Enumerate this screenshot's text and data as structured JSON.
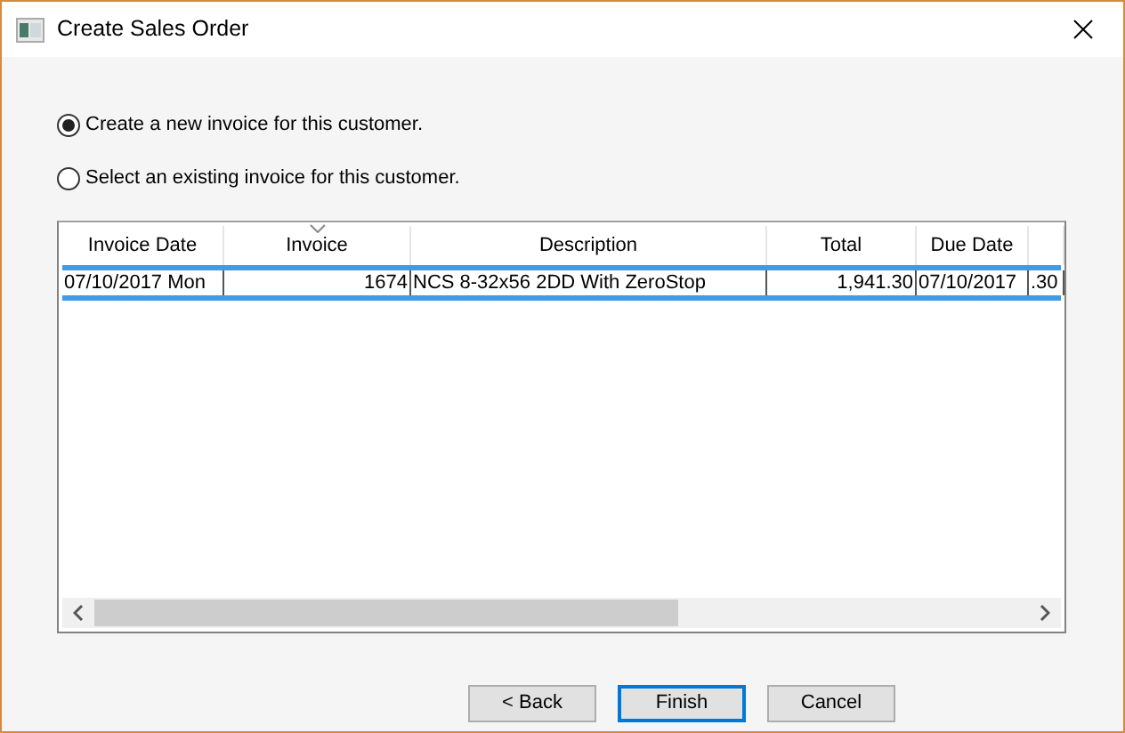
{
  "window": {
    "title": "Create Sales Order"
  },
  "options": [
    {
      "label": "Create a new invoice for this customer.",
      "selected": true
    },
    {
      "label": "Select an existing invoice for this customer.",
      "selected": false
    }
  ],
  "table": {
    "columns": [
      {
        "label": "Invoice Date",
        "kind": "text",
        "sorted": false
      },
      {
        "label": "Invoice",
        "kind": "number",
        "sorted": true
      },
      {
        "label": "Description",
        "kind": "text",
        "sorted": false
      },
      {
        "label": "Total",
        "kind": "number",
        "sorted": false
      },
      {
        "label": "Due Date",
        "kind": "text",
        "sorted": false
      },
      {
        "kind": "text",
        "sorted": false
      }
    ],
    "rows": [
      {
        "selected": true,
        "cells": [
          "07/10/2017 Mon",
          "1674",
          "NCS 8-32x56 2DD With ZeroStop",
          "1,941.30",
          "07/10/2017",
          ".30"
        ]
      }
    ]
  },
  "buttons": [
    {
      "label": "< Back",
      "default": false
    },
    {
      "label": "Finish",
      "default": true
    },
    {
      "label": "Cancel",
      "default": false
    }
  ]
}
